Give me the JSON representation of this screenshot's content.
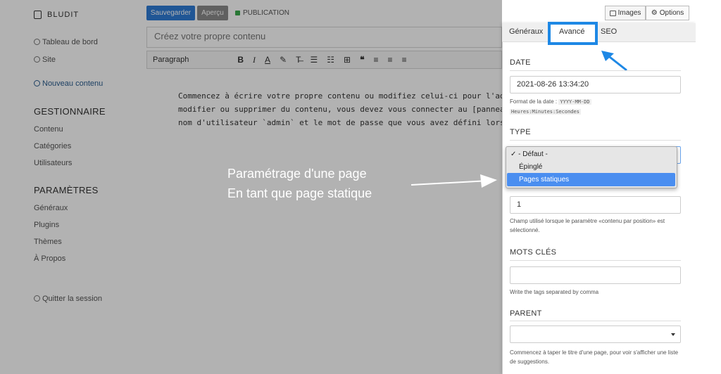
{
  "app": {
    "logo_text": "BLUDIT"
  },
  "sidebar": {
    "items": [
      {
        "label": "Tableau de bord"
      },
      {
        "label": "Site"
      },
      {
        "label": "Nouveau contenu"
      }
    ],
    "section1": {
      "title": "GESTIONNAIRE",
      "items": [
        "Contenu",
        "Catégories",
        "Utilisateurs"
      ]
    },
    "section2": {
      "title": "PARAMÈTRES",
      "items": [
        "Généraux",
        "Plugins",
        "Thèmes",
        "À Propos"
      ]
    },
    "logout": "Quitter la session"
  },
  "topbar": {
    "save_label": "Sauvegarder",
    "preview_label": "Aperçu",
    "publication_label": "PUBLICATION",
    "images_label": "Images",
    "options_label": "Options"
  },
  "editor": {
    "title_placeholder": "Créez votre propre contenu",
    "paragraph_label": "Paragraph",
    "body_lines": [
      "Commencez à écrire votre propre contenu ou modifiez celui-ci pour l'adapt",
      "modifier ou supprimer du contenu, vous devez vous connecter au [panneau",
      "nom d'utilisateur `admin` et le mot de passe que vous avez défini lors du"
    ]
  },
  "annotation": {
    "line1": "Paramétrage d'une page",
    "line2": "En tant que page statique"
  },
  "panel": {
    "tabs": [
      {
        "label": "Généraux"
      },
      {
        "label": "Avancé"
      },
      {
        "label": "SEO"
      }
    ],
    "date_label": "DATE",
    "date_value": "2021-08-26 13:34:20",
    "date_help_prefix": "Format de la date :",
    "date_help_code1": "YYYY-MM-DD",
    "date_help_code2": "Heures:Minutes:Secondes",
    "type_label": "TYPE",
    "type_options": [
      {
        "label": "✓ - Défaut -"
      },
      {
        "label": "Épinglé"
      },
      {
        "label": "Pages statiques"
      }
    ],
    "position_value": "1",
    "position_help": "Champ utilisé lorsque le paramètre «contenu par position» est sélectionné.",
    "keywords_label": "MOTS CLÉS",
    "keywords_help": "Write the tags separated by comma",
    "parent_label": "PARENT",
    "parent_help": "Commencez à taper le titre d'une page, pour voir s'afficher une liste de suggestions."
  },
  "colors": {
    "accent": "#1e88e5",
    "save_button": "#2f7bd6",
    "dropdown_highlight": "#4a8ef0"
  }
}
